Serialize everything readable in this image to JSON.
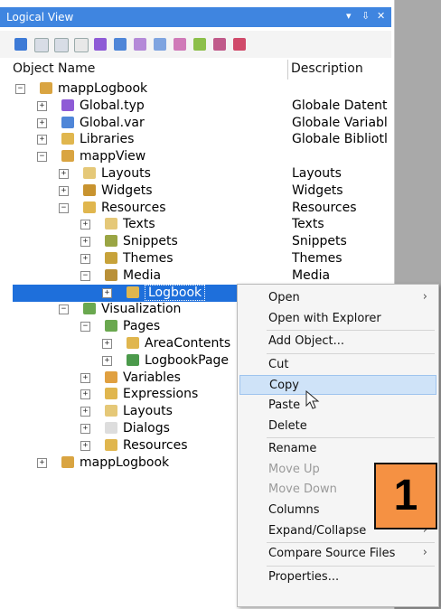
{
  "panel": {
    "title": "Logical View",
    "controls": {
      "dropdown": "▾",
      "pin": "⇩",
      "close": "✕"
    }
  },
  "columns": {
    "name": "Object Name",
    "description": "Description"
  },
  "tree": [
    {
      "label": "mappLogbook",
      "desc": "",
      "level": 0,
      "exp": "−",
      "icon": "#d9a441"
    },
    {
      "label": "Global.typ",
      "desc": "Globale Datent",
      "level": 1,
      "exp": "+",
      "icon": "#8e5bd6"
    },
    {
      "label": "Global.var",
      "desc": "Globale Variabl",
      "level": 1,
      "exp": "+",
      "icon": "#4f86d8"
    },
    {
      "label": "Libraries",
      "desc": "Globale Bibliotl",
      "level": 1,
      "exp": "+",
      "icon": "#e0b64e"
    },
    {
      "label": "mappView",
      "desc": "",
      "level": 1,
      "exp": "−",
      "icon": "#d9a441"
    },
    {
      "label": "Layouts",
      "desc": "Layouts",
      "level": 2,
      "exp": "+",
      "icon": "#e5c878"
    },
    {
      "label": "Widgets",
      "desc": "Widgets",
      "level": 2,
      "exp": "+",
      "icon": "#c8932f"
    },
    {
      "label": "Resources",
      "desc": "Resources",
      "level": 2,
      "exp": "−",
      "icon": "#e0b64e"
    },
    {
      "label": "Texts",
      "desc": "Texts",
      "level": 3,
      "exp": "+",
      "icon": "#e5c878"
    },
    {
      "label": "Snippets",
      "desc": "Snippets",
      "level": 3,
      "exp": "+",
      "icon": "#9aa544"
    },
    {
      "label": "Themes",
      "desc": "Themes",
      "level": 3,
      "exp": "+",
      "icon": "#c7a23a"
    },
    {
      "label": "Media",
      "desc": "Media",
      "level": 3,
      "exp": "−",
      "icon": "#b99038"
    },
    {
      "label": "Logbook",
      "desc": "",
      "level": 4,
      "exp": "+",
      "icon": "#e0b64e",
      "selected": true
    },
    {
      "label": "Visualization",
      "desc": "",
      "level": 2,
      "exp": "−",
      "icon": "#6aa84f"
    },
    {
      "label": "Pages",
      "desc": "",
      "level": 3,
      "exp": "−",
      "icon": "#6aa84f"
    },
    {
      "label": "AreaContents",
      "desc": "",
      "level": 4,
      "exp": "+",
      "icon": "#e0b64e"
    },
    {
      "label": "LogbookPage",
      "desc": "",
      "level": 4,
      "exp": "+",
      "icon": "#4b9a4b"
    },
    {
      "label": "Variables",
      "desc": "",
      "level": 3,
      "exp": "+",
      "icon": "#e0a040"
    },
    {
      "label": "Expressions",
      "desc": "",
      "level": 3,
      "exp": "+",
      "icon": "#e0b64e"
    },
    {
      "label": "Layouts",
      "desc": "",
      "level": 3,
      "exp": "+",
      "icon": "#e5c878"
    },
    {
      "label": "Dialogs",
      "desc": "",
      "level": 3,
      "exp": "+",
      "icon": "#dddddd"
    },
    {
      "label": "Resources",
      "desc": "",
      "level": 3,
      "exp": "+",
      "icon": "#e0b64e"
    },
    {
      "label": "mappLogbook",
      "desc": "",
      "level": 1,
      "exp": "+",
      "icon": "#d9a441"
    }
  ],
  "context_menu": [
    {
      "label": "Open",
      "submenu": true
    },
    {
      "label": "Open with Explorer"
    },
    {
      "sep": true
    },
    {
      "label": "Add Object..."
    },
    {
      "sep": true
    },
    {
      "label": "Cut"
    },
    {
      "label": "Copy",
      "highlighted": true
    },
    {
      "label": "Paste"
    },
    {
      "label": "Delete"
    },
    {
      "sep": true
    },
    {
      "label": "Rename"
    },
    {
      "label": "Move Up",
      "disabled": true
    },
    {
      "label": "Move Down",
      "disabled": true
    },
    {
      "label": "Columns"
    },
    {
      "label": "Expand/Collapse",
      "submenu": true
    },
    {
      "sep": true
    },
    {
      "label": "Compare Source Files",
      "submenu": true
    },
    {
      "sep": true
    },
    {
      "label": "Properties..."
    }
  ],
  "callout": {
    "number": "1",
    "color": "#f59143"
  },
  "colors": {
    "titlebar": "#3f85e0",
    "selection": "#1e6fdb",
    "menu_highlight": "#cfe3f8"
  }
}
